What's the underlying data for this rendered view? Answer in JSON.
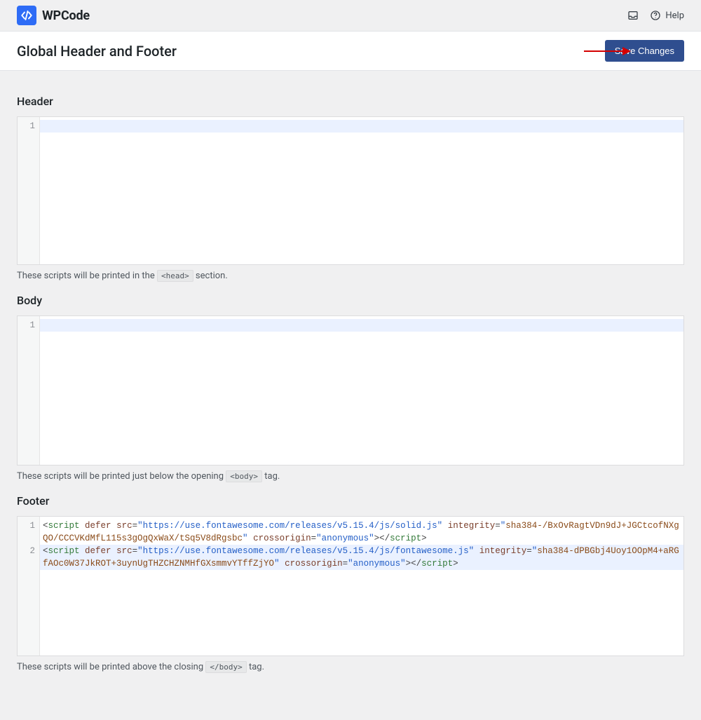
{
  "brand": {
    "name": "WPCode"
  },
  "topbar": {
    "help_label": "Help"
  },
  "page": {
    "title": "Global Header and Footer",
    "save_label": "Save Changes"
  },
  "sections": {
    "header": {
      "title": "Header",
      "lines": 1,
      "hint_pre": "These scripts will be printed in the ",
      "hint_code": "<head>",
      "hint_post": " section."
    },
    "body": {
      "title": "Body",
      "lines": 1,
      "hint_pre": "These scripts will be printed just below the opening ",
      "hint_code": "<body>",
      "hint_post": " tag."
    },
    "footer": {
      "title": "Footer",
      "hint_pre": "These scripts will be printed above the closing ",
      "hint_code": "</body>",
      "hint_post": " tag.",
      "code": [
        {
          "tag": "script",
          "attrs": {
            "defer": true,
            "src": "https://use.fontawesome.com/releases/v5.15.4/js/solid.js",
            "integrity": "sha384-/BxOvRagtVDn9dJ+JGCtcofNXgQO/CCCVKdMfL115s3gOgQxWaX/tSq5V8dRgsbc",
            "crossorigin": "anonymous"
          }
        },
        {
          "tag": "script",
          "attrs": {
            "defer": true,
            "src": "https://use.fontawesome.com/releases/v5.15.4/js/fontawesome.js",
            "integrity": "sha384-dPBGbj4Uoy1OOpM4+aRGfAOc0W37JkROT+3uynUgTHZCHZNMHfGXsmmvYTffZjYO",
            "crossorigin": "anonymous"
          }
        }
      ]
    }
  }
}
